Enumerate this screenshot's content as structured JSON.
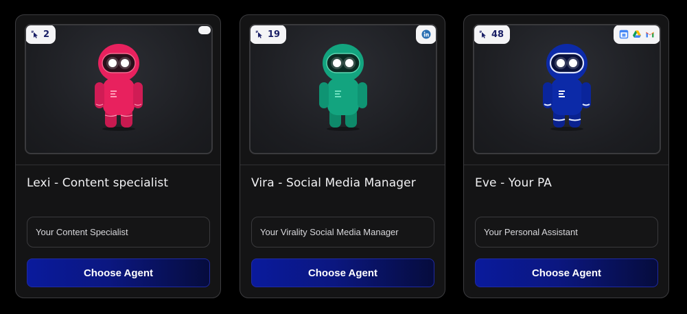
{
  "agents": [
    {
      "usage_count": "2",
      "usage_icon": "cursor-click-icon",
      "tool_icons": [],
      "robot_color": "#e8215e",
      "title": "Lexi - Content specialist",
      "description": "Your Content Specialist",
      "button_label": "Choose Agent"
    },
    {
      "usage_count": "19",
      "usage_icon": "cursor-click-icon",
      "tool_icons": [
        "linkedin-icon"
      ],
      "robot_color": "#13a47f",
      "title": "Vira - Social Media Manager",
      "description": "Your Virality Social Media Manager",
      "button_label": "Choose Agent"
    },
    {
      "usage_count": "48",
      "usage_icon": "cursor-click-icon",
      "tool_icons": [
        "google-calendar-icon",
        "google-drive-icon",
        "gmail-icon"
      ],
      "robot_color": "#0c2aa8",
      "title": "Eve - Your PA",
      "description": "Your Personal Assistant",
      "button_label": "Choose Agent"
    }
  ],
  "colors": {
    "background": "#000000",
    "card": "#141415",
    "button_start": "#0a1a9c",
    "button_end": "#060c3d",
    "usage_text": "#1a1f66"
  }
}
